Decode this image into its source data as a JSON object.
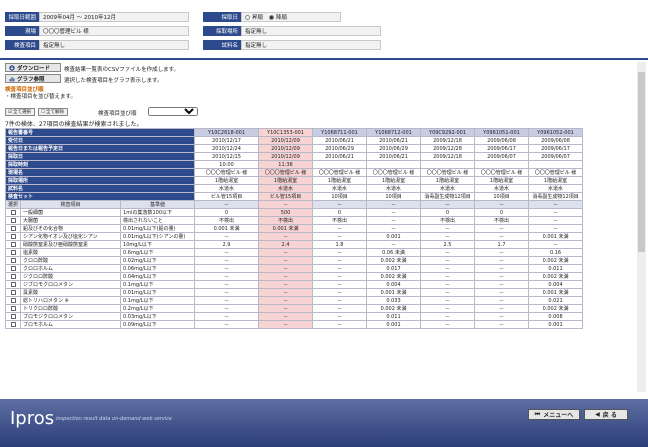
{
  "header": {
    "period_label": "採取日範囲",
    "period_value": "2009年04月 ～ 2010年12月",
    "field_label": "現場",
    "field_value": "〇〇〇管理ビル 様",
    "item_label": "検査項目",
    "item_value": "指定無し",
    "date_label": "採取日",
    "radio_asc": "昇順",
    "radio_desc": "降順",
    "place_label": "採取場所",
    "place_value": "指定無し",
    "sample_label": "試料名",
    "sample_value": "指定無し"
  },
  "actions": {
    "download_label": "ダウンロード",
    "download_desc": "検査結果一覧表のCSVファイルを作成します。",
    "graph_label": "グラフ参照",
    "graph_desc": "選択した検査項目をグラフ表示します。",
    "sort_title": "検査項目並び順",
    "sort_note": "・検査項目を並び替えます。",
    "select_all": "全て選択",
    "clear_all": "全て解除",
    "sort_select_label": "検査項目並び順",
    "sort_select_value": "",
    "count_text": "7件の検体、27項目の検査結果が検索されました。"
  },
  "table": {
    "info_rows": [
      {
        "label": "報告書番号",
        "values": [
          "Y10C2618-001",
          "Y10C1353-001",
          "Y1068711-001",
          "Y1068712-001",
          "Y09C9292-001",
          "Y0961051-001",
          "Y0961052-001"
        ]
      },
      {
        "label": "受付日",
        "values": [
          "2010/12/17",
          "2010/12/09",
          "2010/06/21",
          "2010/06/21",
          "2009/12/18",
          "2009/06/08",
          "2009/06/08"
        ]
      },
      {
        "label": "報告日または報告予定日",
        "values": [
          "2010/12/24",
          "2010/12/09",
          "2010/06/29",
          "2010/06/29",
          "2009/12/28",
          "2009/06/17",
          "2009/06/17"
        ]
      },
      {
        "label": "採取日",
        "values": [
          "2010/12/15",
          "2010/12/09",
          "2010/06/21",
          "2010/06/21",
          "2009/12/18",
          "2009/06/07",
          "2009/06/07"
        ]
      },
      {
        "label": "採取時刻",
        "values": [
          "10:00",
          "11:38",
          "",
          "",
          "",
          "",
          ""
        ]
      },
      {
        "label": "現場名",
        "values": [
          "〇〇〇管理ビル 様",
          "〇〇〇管理ビル 様",
          "〇〇〇管理ビル 様",
          "〇〇〇管理ビル 様",
          "〇〇〇管理ビル 様",
          "〇〇〇管理ビル 様",
          "〇〇〇管理ビル 様"
        ]
      },
      {
        "label": "採取場所",
        "values": [
          "1階給湯室",
          "1階給湯室",
          "1階給湯室",
          "1階給湯室",
          "1階給湯室",
          "1階給湯室",
          "1階給湯室"
        ]
      },
      {
        "label": "試料名",
        "values": [
          "水道水",
          "水道水",
          "水道水",
          "水道水",
          "水道水",
          "水道水",
          "水道水"
        ]
      },
      {
        "label": "検査セット",
        "values": [
          "ビル管15項目",
          "ビル管15項目",
          "10項目",
          "10項目",
          "消毒副生成物12項目",
          "10項目",
          "消毒副生成物12項目"
        ]
      }
    ],
    "col_select": "選択",
    "col_item": "検査項目",
    "col_standard": "基準値",
    "result_rows": [
      {
        "item": "一般細菌",
        "standard": "1mlの集落数100以下",
        "values": [
          "0",
          "500",
          "0",
          "－",
          "0",
          "0",
          "－"
        ]
      },
      {
        "item": "大腸菌",
        "standard": "検出されないこと",
        "values": [
          "不検出",
          "不検出",
          "不検出",
          "－",
          "不検出",
          "不検出",
          "－"
        ]
      },
      {
        "item": "鉛及びその化合物",
        "standard": "0.01mg/L以下(鉛の量)",
        "values": [
          "0.001 未満",
          "0.001 未満",
          "－",
          "－",
          "－",
          "－",
          "－"
        ]
      },
      {
        "item": "シアン化物イオン及び塩化シアン",
        "standard": "0.01mg/L以下(シアンの量)",
        "values": [
          "－",
          "－",
          "－",
          "0.001",
          "－",
          "－",
          "0.001 未満"
        ]
      },
      {
        "item": "硝酸態窒素及び亜硝酸態窒素",
        "standard": "10mg/L以下",
        "values": [
          "2.9",
          "2.4",
          "1.8",
          "－",
          "2.5",
          "1.7",
          "－"
        ]
      },
      {
        "item": "塩素酸",
        "standard": "0.6mg/L以下",
        "values": [
          "－",
          "－",
          "－",
          "0.06 未満",
          "－",
          "－",
          "0.16"
        ]
      },
      {
        "item": "クロロ酢酸",
        "standard": "0.02mg/L以下",
        "values": [
          "－",
          "－",
          "－",
          "0.002 未満",
          "－",
          "－",
          "0.002 未満"
        ]
      },
      {
        "item": "クロロホルム",
        "standard": "0.06mg/L以下",
        "values": [
          "－",
          "－",
          "－",
          "0.017",
          "－",
          "－",
          "0.011"
        ]
      },
      {
        "item": "ジクロロ酢酸",
        "standard": "0.04mg/L以下",
        "values": [
          "－",
          "－",
          "－",
          "0.002 未満",
          "－",
          "－",
          "0.002 未満"
        ]
      },
      {
        "item": "ジブロモクロロメタン",
        "standard": "0.1mg/L以下",
        "values": [
          "－",
          "－",
          "－",
          "0.004",
          "－",
          "－",
          "0.004"
        ]
      },
      {
        "item": "臭素酸",
        "standard": "0.01mg/L以下",
        "values": [
          "－",
          "－",
          "－",
          "0.001 未満",
          "－",
          "－",
          "0.001 未満"
        ]
      },
      {
        "item": "総トリハロメタン ※",
        "standard": "0.1mg/L以下",
        "values": [
          "－",
          "－",
          "－",
          "0.033",
          "－",
          "－",
          "0.021"
        ]
      },
      {
        "item": "トリクロロ酢酸",
        "standard": "0.2mg/L以下",
        "values": [
          "－",
          "－",
          "－",
          "0.002 未満",
          "－",
          "－",
          "0.002 未満"
        ]
      },
      {
        "item": "ブロモジクロロメタン",
        "standard": "0.03mg/L以下",
        "values": [
          "－",
          "－",
          "－",
          "0.011",
          "－",
          "－",
          "0.008"
        ]
      },
      {
        "item": "ブロモホルム",
        "standard": "0.09mg/L以下",
        "values": [
          "－",
          "－",
          "－",
          "0.001",
          "－",
          "－",
          "0.001"
        ]
      }
    ]
  },
  "footer": {
    "logo": "Ipros",
    "tagline": "inspection result data on-demand web service",
    "menu_label": "メニューへ",
    "back_label": "戻 る"
  }
}
